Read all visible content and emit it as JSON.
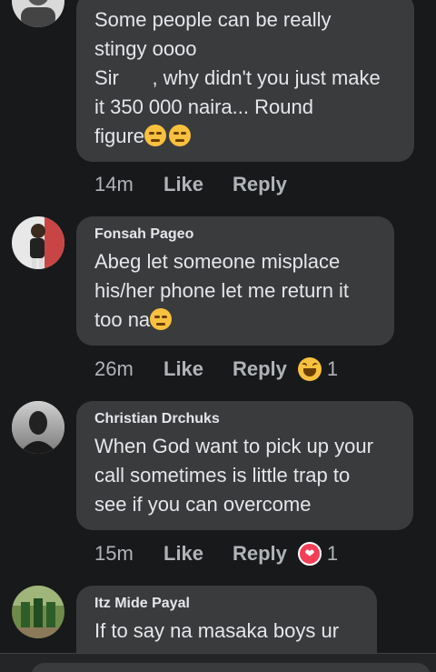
{
  "comments": [
    {
      "author": "",
      "lines": [
        "Some people can be really",
        "stingy oooo",
        "Sir      , why didn't you just make",
        "it 350 000 naira... Round",
        "figure"
      ],
      "time": "14m",
      "like": "Like",
      "reply": "Reply",
      "reaction_icon": "",
      "reaction_count": ""
    },
    {
      "author": "Fonsah Pageo",
      "lines": [
        "Abeg let someone misplace",
        "his/her phone let me return it",
        "too na"
      ],
      "time": "26m",
      "like": "Like",
      "reply": "Reply",
      "reaction_icon": "haha-icon",
      "reaction_count": "1"
    },
    {
      "author": "Christian Drchuks",
      "lines": [
        "When God want to pick up your",
        "call sometimes is little trap to",
        "see if you can overcome"
      ],
      "time": "15m",
      "like": "Like",
      "reply": "Reply",
      "reaction_icon": "love-icon",
      "reaction_count": "1"
    },
    {
      "author": "Itz Mide Payal",
      "lines": [
        "If to say na masaka boys ur"
      ],
      "time": "",
      "like": "",
      "reply": "",
      "reaction_icon": "",
      "reaction_count": ""
    }
  ],
  "colors": {
    "background": "#18191a",
    "bubble": "#3a3b3c",
    "text": "#e4e6eb",
    "secondary": "#b0b3b8",
    "love": "#f33e58",
    "haha": "#f7c13f"
  }
}
